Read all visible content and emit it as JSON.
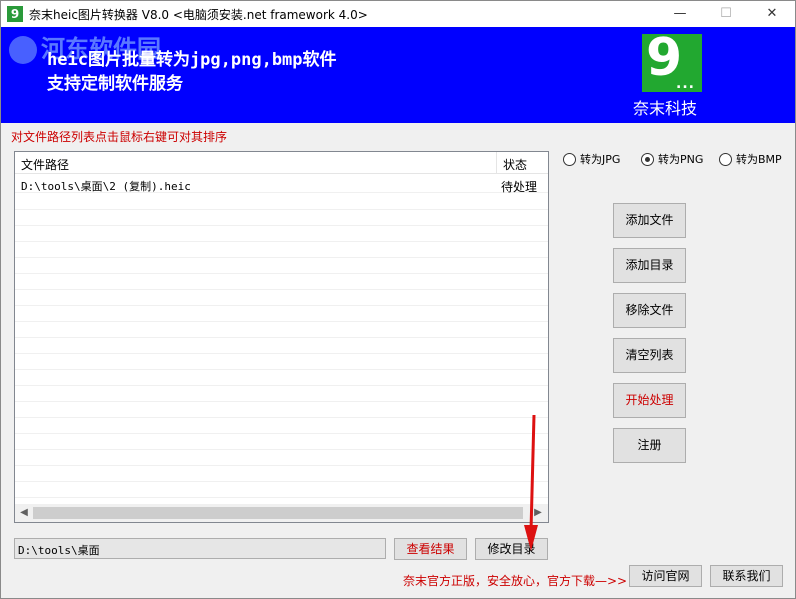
{
  "window": {
    "title": "奈末heic图片转换器 V8.0  <电脑须安装.net framework 4.0>",
    "icon_glyph": "9",
    "minimize_glyph": "—",
    "maximize_glyph": "☐",
    "close_glyph": "✕"
  },
  "banner": {
    "line1": "heic图片批量转为jpg,png,bmp软件",
    "line2": "支持定制软件服务",
    "watermark": "河东软件园",
    "logo_digit": "9",
    "logo_dots": "...",
    "brand_name": "奈末科技",
    "bg_color": "#0000ff"
  },
  "hint": "对文件路径列表点击鼠标右键可对其排序",
  "list": {
    "columns": [
      "文件路径",
      "状态"
    ],
    "rows": [
      {
        "path": "D:\\tools\\桌面\\2 (复制).heic",
        "status": "待处理"
      }
    ],
    "scroll_left_glyph": "◀",
    "scroll_right_glyph": "▶"
  },
  "format_options": [
    {
      "label": "转为JPG",
      "selected": false
    },
    {
      "label": "转为PNG",
      "selected": true
    },
    {
      "label": "转为BMP",
      "selected": false
    }
  ],
  "buttons": {
    "add_file": "添加文件",
    "add_dir": "添加目录",
    "remove_file": "移除文件",
    "clear_list": "清空列表",
    "start": "开始处理",
    "register": "注册",
    "view_result": "查看结果",
    "change_dir": "修改目录",
    "visit_site": "访问官网",
    "contact": "联系我们"
  },
  "output_dir": "D:\\tools\\桌面",
  "footer": "奈末官方正版，安全放心，官方下载—>>",
  "colors": {
    "accent_red": "#cc0000",
    "logo_green": "#22a830"
  }
}
